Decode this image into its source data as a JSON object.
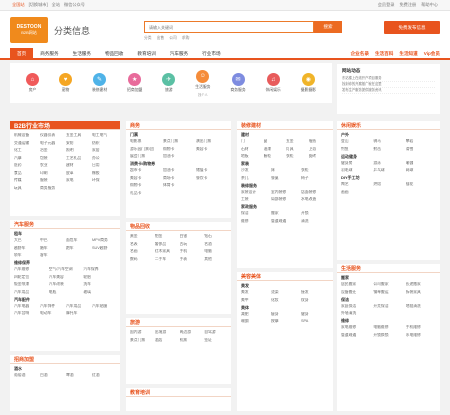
{
  "topbar": {
    "city": "全国站",
    "switch": "[切换城市]",
    "site": "全站",
    "wechat": "微信公众号",
    "right": [
      "会员登录",
      "免费注册",
      "帮助中心"
    ]
  },
  "header": {
    "logo_main": "DESTOON",
    "logo_sub": "B2B网站",
    "slogan": "分类信息"
  },
  "search": {
    "placeholder": "请输入关键词",
    "button": "搜索",
    "hot": [
      "分类",
      "出售",
      "公司",
      "求购"
    ]
  },
  "post_button": "免费发布信息",
  "nav": {
    "items": [
      "首页",
      "商务服务",
      "生活服务",
      "物品回收",
      "教育培训",
      "汽车服务",
      "行业市场"
    ],
    "right": [
      "企业名录",
      "生活百科",
      "生活知道",
      "Vip会员"
    ]
  },
  "icons": [
    {
      "label": "房产",
      "color": "#f05a5a",
      "glyph": "⌂",
      "sub": ""
    },
    {
      "label": "宠物",
      "color": "#f5a623",
      "glyph": "♥",
      "sub": ""
    },
    {
      "label": "装修建材",
      "color": "#4fb3e8",
      "glyph": "✎",
      "sub": ""
    },
    {
      "label": "招商加盟",
      "color": "#e86b9b",
      "glyph": "★",
      "sub": ""
    },
    {
      "label": "旅游",
      "color": "#5bc0a4",
      "glyph": "✈",
      "sub": ""
    },
    {
      "label": "生活服务",
      "color": "#f58c3a",
      "glyph": "☺",
      "sub": "找个人"
    },
    {
      "label": "商务服务",
      "color": "#7e8ce0",
      "glyph": "✉",
      "sub": ""
    },
    {
      "label": "休闲娱乐",
      "color": "#e85b5b",
      "glyph": "♫",
      "sub": ""
    },
    {
      "label": "摄影摄影",
      "color": "#f0b429",
      "glyph": "◉",
      "sub": ""
    }
  ],
  "news": {
    "title": "网站动态",
    "items": [
      "东站楼上在线开户项目服务",
      "找到你的开展推广就在这里",
      "发布生产服务提供服务资讯"
    ]
  },
  "columns": [
    {
      "title": "B2B行业市场",
      "orange": true,
      "sections": [
        {
          "name": "",
          "cols": 4,
          "items": [
            "机械设备",
            "仪器仪表",
            "五金工具",
            "电工电气",
            "交通运输",
            "电子元器",
            "安防",
            "纺织",
            "化工",
            "冶金",
            "照明",
            "家居",
            "汽摩",
            "包装",
            "工艺礼品",
            "办公",
            "医药",
            "农业",
            "建材",
            "日用",
            "食品",
            "印刷",
            "皮革",
            "橡胶",
            "传媒",
            "服装",
            "家电",
            "环保",
            "玩具",
            "商务服务",
            "",
            ""
          ]
        }
      ]
    },
    {
      "title": "汽车服务",
      "sections": [
        {
          "name": "租车",
          "cols": 4,
          "items": [
            "大巴",
            "中巴",
            "面包车",
            "MPV商务",
            "越野车",
            "婚车",
            "跑车",
            "SUV越野",
            "轿车",
            "客车",
            "",
            ""
          ]
        },
        {
          "name": "维修保养",
          "cols": 3,
          "items": [
            "汽车维修",
            "空气/汽车空调",
            "汽车保养",
            "四轮定位",
            "汽车美容",
            "轮胎",
            "钣金喷漆",
            "汽车改装",
            "洗车",
            "汽车用品",
            "电瓶",
            "玻璃"
          ]
        },
        {
          "name": "汽车配件",
          "cols": 4,
          "items": [
            "汽车电器",
            "汽车饰件",
            "汽车用品",
            "汽车贴膜",
            "汽车音响",
            "电动车",
            "摩托车",
            "",
            ""
          ]
        }
      ]
    },
    {
      "title": "招商加盟",
      "sections": [
        {
          "name": "酒水",
          "cols": 4,
          "items": [
            "葡萄酒",
            "白酒",
            "啤酒",
            "红酒"
          ]
        }
      ]
    }
  ],
  "columns2": [
    {
      "title": "商务",
      "sections": [
        {
          "name": "门票",
          "cols": 3,
          "items": [
            "电影票",
            "景点门票",
            "演出门票",
            "游乐园门票/团",
            "购物卡",
            "美容卡",
            "展会门票",
            "加油卡",
            ""
          ]
        },
        {
          "name": "消费卡/购物券",
          "cols": 3,
          "items": [
            "超市卡",
            "加油卡",
            "储值卡",
            "美容卡",
            "商场卡",
            "餐饮卡",
            "购物卡",
            "体育卡",
            "",
            "礼品卡",
            "",
            ""
          ]
        }
      ]
    },
    {
      "title": "物品回收",
      "sections": [
        {
          "name": "",
          "cols": 4,
          "items": [
            "黄金",
            "铂金",
            "白银",
            "钻石",
            "名表",
            "奢侈品",
            "古玩",
            "名酒",
            "名画",
            "红木家具",
            "手机",
            "电脑",
            "数码",
            "二手车",
            "手表",
            "其他"
          ]
        }
      ]
    },
    {
      "title": "旅游",
      "sections": [
        {
          "name": "",
          "cols": 4,
          "items": [
            "国内游",
            "出境游",
            "周边游",
            "自驾游",
            "景点门票",
            "酒店",
            "机票",
            "签证"
          ]
        }
      ]
    },
    {
      "title": "教育培训",
      "sections": []
    }
  ],
  "columns3": [
    {
      "title": "装修建材",
      "sections": [
        {
          "name": "建材",
          "cols": 4,
          "items": [
            "门",
            "窗",
            "五金",
            "墙纸",
            "石材",
            "油漆",
            "灯具",
            "卫浴",
            "地板",
            "橱柜",
            "衣柜",
            "瓷砖"
          ]
        },
        {
          "name": "家装",
          "cols": 3,
          "items": [
            "沙发",
            "床",
            "衣柜",
            "茶几",
            "餐桌",
            "椅子"
          ]
        },
        {
          "name": "装修服务",
          "cols": 3,
          "items": [
            "家装设计",
            "室内装修",
            "店面装修",
            "工装",
            "局部装修",
            "水电改造"
          ]
        },
        {
          "name": "家政服务",
          "cols": 3,
          "items": [
            "保洁",
            "搬家",
            "开锁",
            "维修",
            "管道疏通",
            "清洗"
          ]
        }
      ]
    },
    {
      "title": "美容美体",
      "sections": [
        {
          "name": "美发",
          "cols": 3,
          "items": [
            "美发",
            "烫染",
            "接发",
            "美甲",
            "化妆",
            "纹身"
          ]
        },
        {
          "name": "美体",
          "cols": 3,
          "items": [
            "减肥",
            "瘦身",
            "健身",
            "瑜伽",
            "按摩",
            "SPA"
          ]
        }
      ]
    }
  ],
  "columns4": [
    {
      "title": "休闲娱乐",
      "sections": [
        {
          "name": "户外",
          "cols": 3,
          "items": [
            "登山",
            "骑马",
            "攀岩",
            "钓鱼",
            "射击",
            "滑雪"
          ]
        },
        {
          "name": "运动健身",
          "cols": 3,
          "items": [
            "健身房",
            "游泳",
            "瑜伽",
            "羽毛球",
            "乒乓球",
            "网球"
          ]
        },
        {
          "name": "DIY手工坊",
          "cols": 3,
          "items": [
            "陶艺",
            "烘焙",
            "插花",
            "画画"
          ]
        }
      ]
    },
    {
      "title": "生活服务",
      "sections": [
        {
          "name": "搬家",
          "cols": 3,
          "items": [
            "居民搬家",
            "公司搬家",
            "长途搬家",
            "设备搬迁",
            "钢琴搬运",
            "拆装家具"
          ]
        },
        {
          "name": "保洁",
          "cols": 3,
          "items": [
            "家庭保洁",
            "开荒保洁",
            "地毯清洗",
            "外墙清洗"
          ]
        },
        {
          "name": "维修",
          "cols": 3,
          "items": [
            "家电维修",
            "电脑维修",
            "手机维修",
            "管道疏通",
            "开锁换锁",
            "水电维修"
          ]
        }
      ]
    }
  ]
}
